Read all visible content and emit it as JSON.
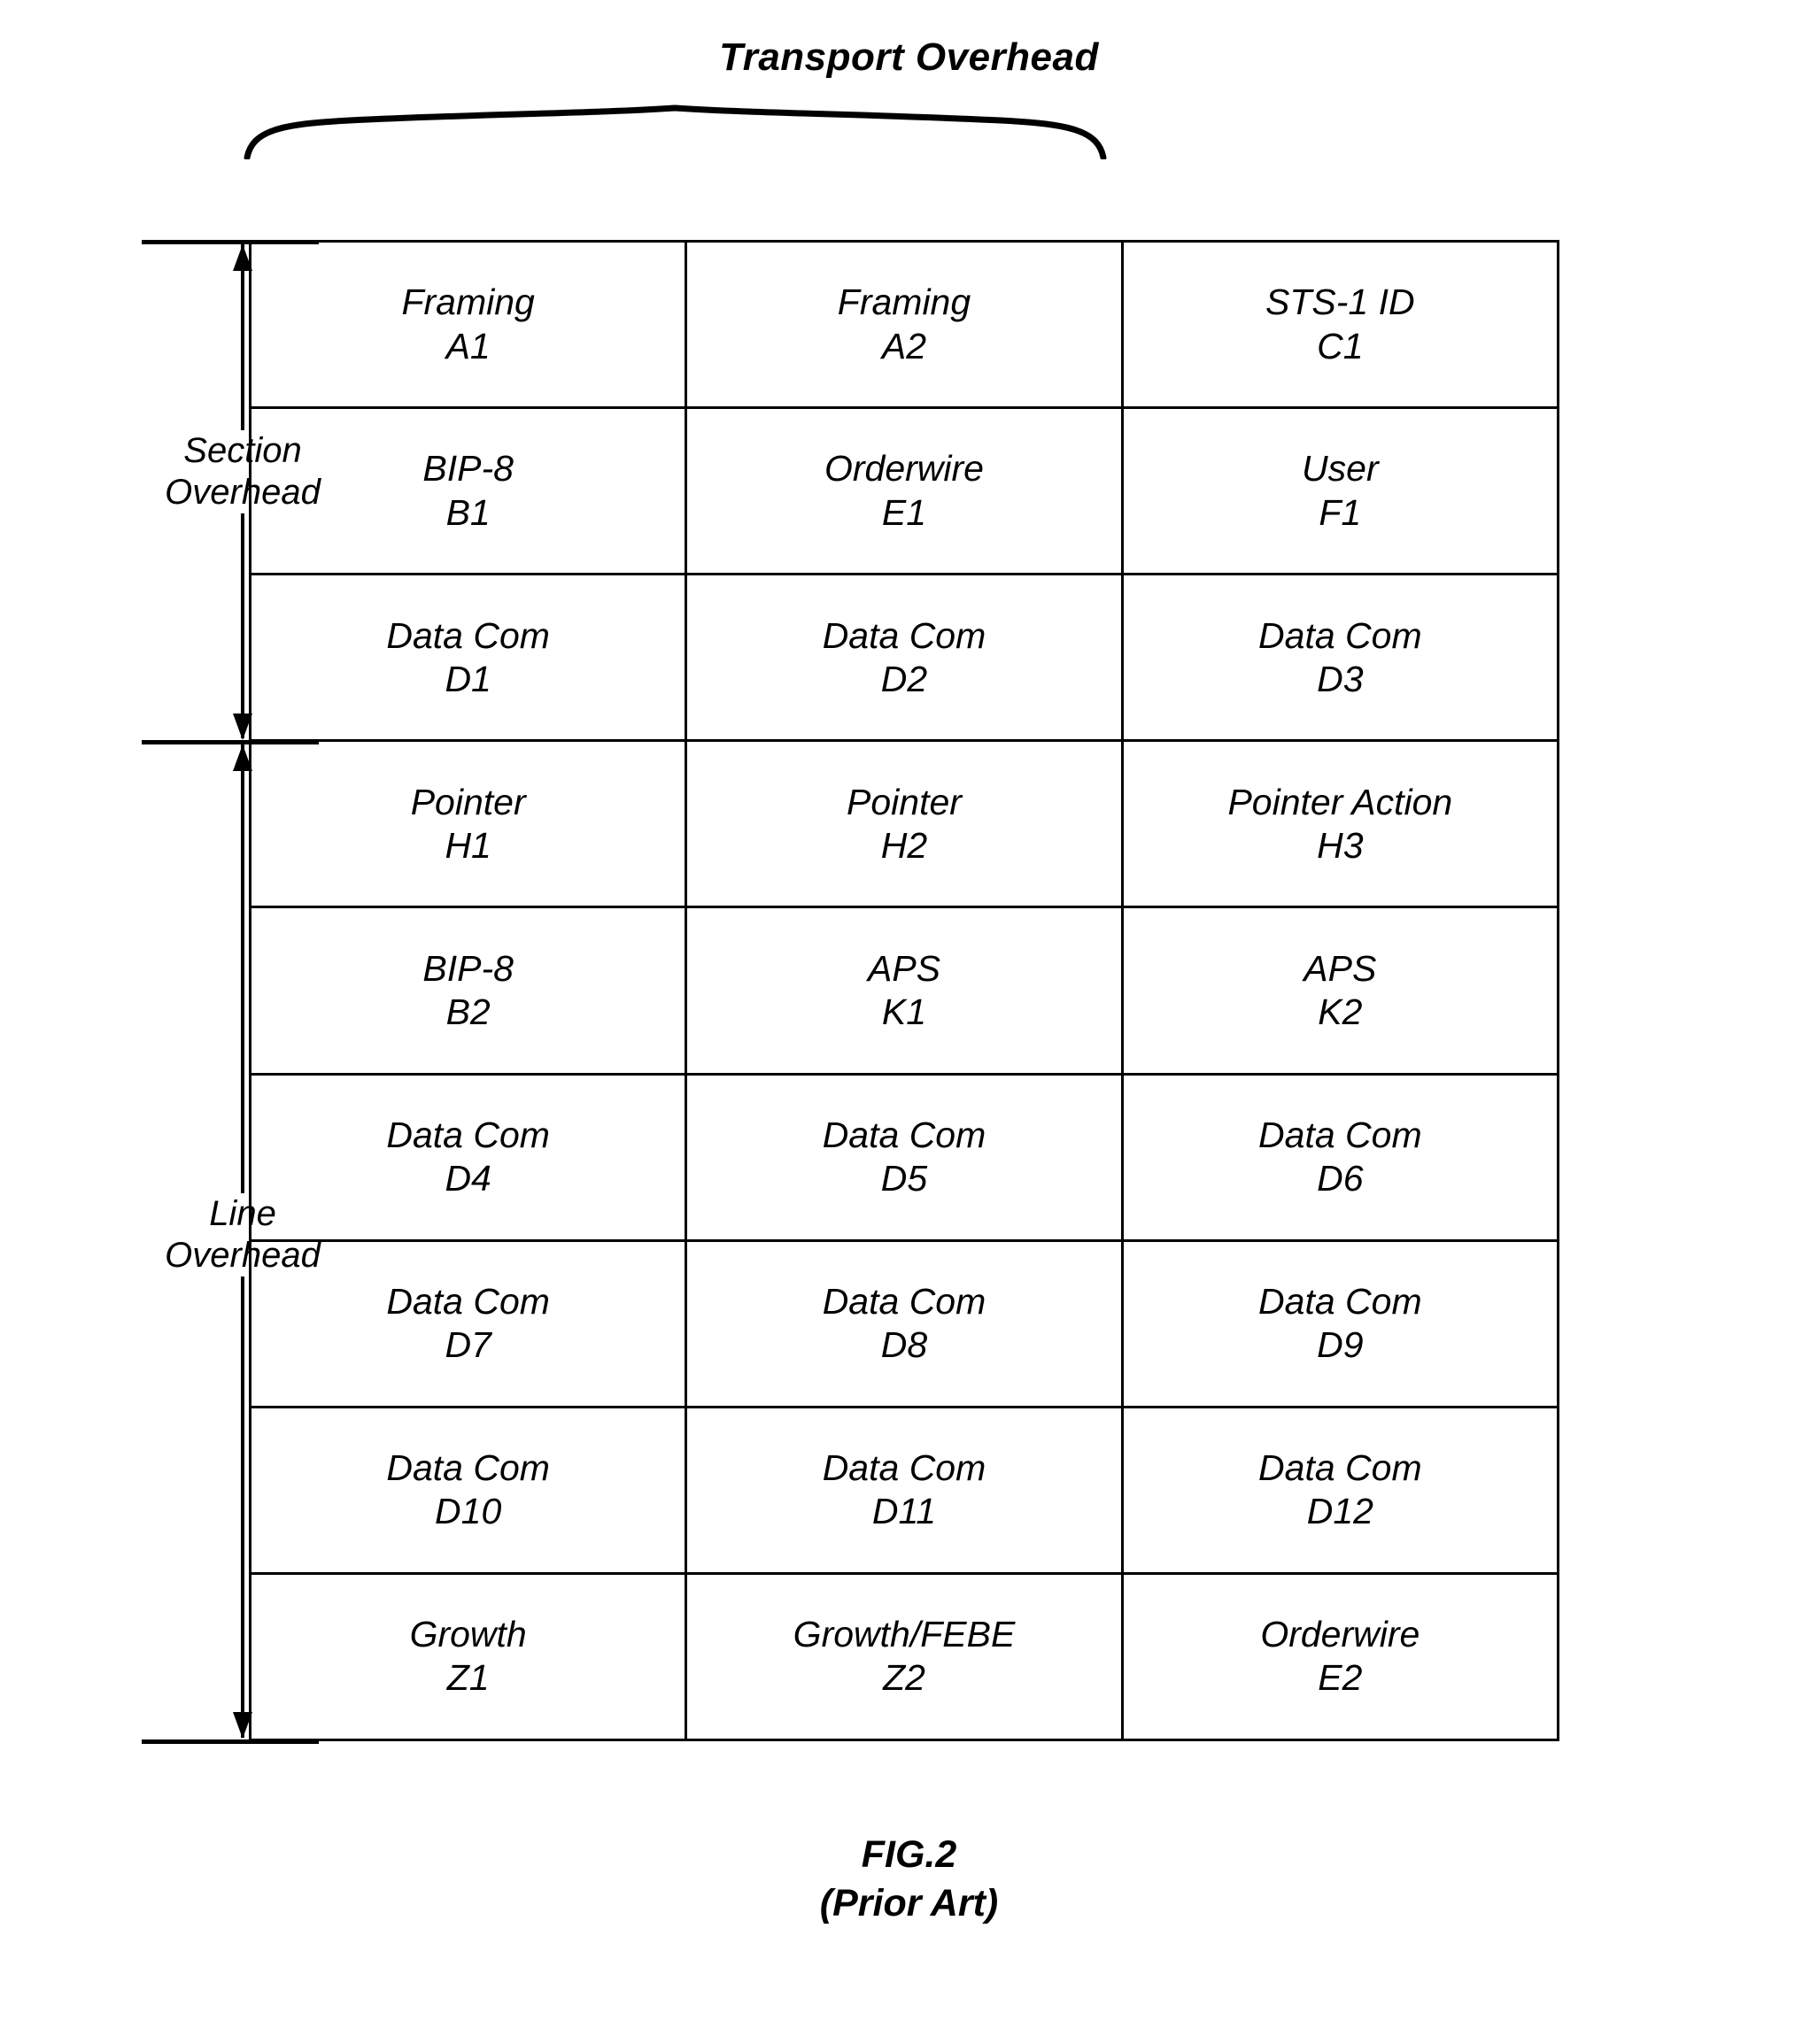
{
  "figure": {
    "title": "Transport Overhead",
    "caption_line1": "FIG.2",
    "caption_line2": "(Prior Art)"
  },
  "axis_labels": {
    "section": "Section\nOverhead",
    "section_line1": "Section",
    "section_line2": "Overhead",
    "line_line1": "Line",
    "line_line2": "Overhead"
  },
  "table": {
    "columns": 3,
    "rows": [
      [
        {
          "name": "Framing",
          "code": "A1"
        },
        {
          "name": "Framing",
          "code": "A2"
        },
        {
          "name": "STS-1 ID",
          "code": "C1"
        }
      ],
      [
        {
          "name": "BIP-8",
          "code": "B1"
        },
        {
          "name": "Orderwire",
          "code": "E1"
        },
        {
          "name": "User",
          "code": "F1"
        }
      ],
      [
        {
          "name": "Data Com",
          "code": "D1"
        },
        {
          "name": "Data Com",
          "code": "D2"
        },
        {
          "name": "Data Com",
          "code": "D3"
        }
      ],
      [
        {
          "name": "Pointer",
          "code": "H1"
        },
        {
          "name": "Pointer",
          "code": "H2"
        },
        {
          "name": "Pointer Action",
          "code": "H3"
        }
      ],
      [
        {
          "name": "BIP-8",
          "code": "B2"
        },
        {
          "name": "APS",
          "code": "K1"
        },
        {
          "name": "APS",
          "code": "K2"
        }
      ],
      [
        {
          "name": "Data Com",
          "code": "D4"
        },
        {
          "name": "Data Com",
          "code": "D5"
        },
        {
          "name": "Data Com",
          "code": "D6"
        }
      ],
      [
        {
          "name": "Data Com",
          "code": "D7"
        },
        {
          "name": "Data Com",
          "code": "D8"
        },
        {
          "name": "Data Com",
          "code": "D9"
        }
      ],
      [
        {
          "name": "Data Com",
          "code": "D10"
        },
        {
          "name": "Data Com",
          "code": "D11"
        },
        {
          "name": "Data Com",
          "code": "D12"
        }
      ],
      [
        {
          "name": "Growth",
          "code": "Z1"
        },
        {
          "name": "Growth/FEBE",
          "code": "Z2"
        },
        {
          "name": "Orderwire",
          "code": "E2"
        }
      ]
    ]
  },
  "colors": {
    "ink": "#000000",
    "paper": "#ffffff"
  }
}
